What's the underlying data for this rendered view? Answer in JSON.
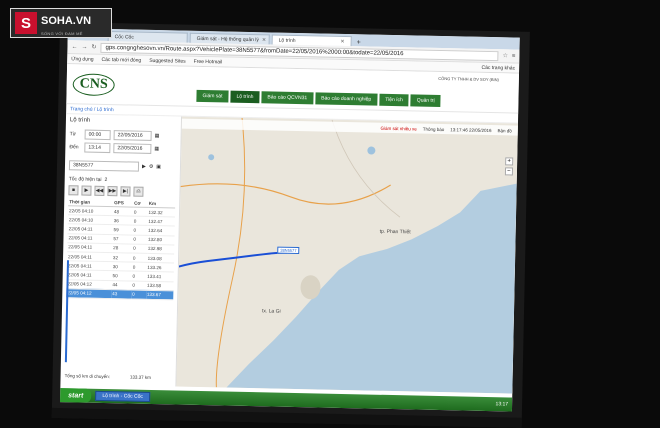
{
  "overlay_logo": {
    "brand": "SOHA.VN",
    "letter": "S",
    "tagline": "SỐNG VỚI ĐAM MÊ"
  },
  "browser": {
    "tabs": [
      {
        "label": "Cốc Cốc"
      },
      {
        "label": "Giám sát - Hệ thống quản lý"
      },
      {
        "label": "Lộ trình"
      }
    ],
    "url": "gps.congnghesovn.vn/Route.aspx?VehiclePlate=38N5577&fromDate=22/05/2016%2000:00&todate=22/05/2016",
    "bookmarks": [
      "Ứng dụng",
      "Các tab mới đóng",
      "Suggested Sites",
      "Free Hotmail"
    ],
    "bookmarks_right": "Các trang khác"
  },
  "site": {
    "logo": "CNS",
    "company": "CÔNG TY TNHH & DV SOY (BIN)",
    "nav": [
      "Giám sát",
      "Lộ trình",
      "Báo cáo QCVN31",
      "Báo cáo doanh nghiệp",
      "Tiện ích",
      "Quản trị"
    ],
    "breadcrumb": "Trang chủ / Lộ trình"
  },
  "panel": {
    "title": "Lộ trình",
    "from_label": "Từ",
    "from_time": "00:00",
    "from_date": "22/05/2016",
    "to_label": "Đến",
    "to_time": "13:14",
    "to_date": "22/05/2016",
    "plate": "38N5577",
    "speed_label": "Tốc độ hiện tại",
    "speed_value": "2",
    "columns": [
      "Thời gian",
      "GPS",
      "Cơ",
      "Km"
    ],
    "rows": [
      [
        "22/05 04:10",
        "48",
        "0",
        "132.32"
      ],
      [
        "22/05 04:10",
        "36",
        "0",
        "132.47"
      ],
      [
        "22/05 04:11",
        "59",
        "0",
        "132.64"
      ],
      [
        "22/05 04:11",
        "57",
        "0",
        "132.80"
      ],
      [
        "22/05 04:11",
        "28",
        "0",
        "132.98"
      ],
      [
        "22/05 04:11",
        "32",
        "0",
        "133.08"
      ],
      [
        "22/05 04:11",
        "30",
        "0",
        "133.26"
      ],
      [
        "22/05 04:11",
        "50",
        "0",
        "133.41"
      ],
      [
        "22/05 04:12",
        "44",
        "0",
        "133.58"
      ],
      [
        "22/05 04:12",
        "43",
        "0",
        "133.67"
      ]
    ],
    "total_label": "Tổng số km di chuyển:",
    "total_value": "133.37 km"
  },
  "map": {
    "tool_monitor": "Giám sát nhiều xe",
    "tool_notify": "Thông báo",
    "tool_time": "13:17:46 22/05/2016",
    "type": "Bản đồ",
    "zoom_in": "+",
    "zoom_out": "−",
    "labels": {
      "city1": "tp. Phan Thiết",
      "city2": "tx. La Gi"
    },
    "vehicle": "38N5577"
  },
  "taskbar": {
    "start": "start",
    "window": "Lộ trình - Cốc Cốc",
    "tray": "13:17"
  },
  "colors": {
    "nav_green": "#2e7d32",
    "route_blue": "#1a4fd6",
    "sea": "#b3cde0",
    "land": "#eae6dc"
  }
}
